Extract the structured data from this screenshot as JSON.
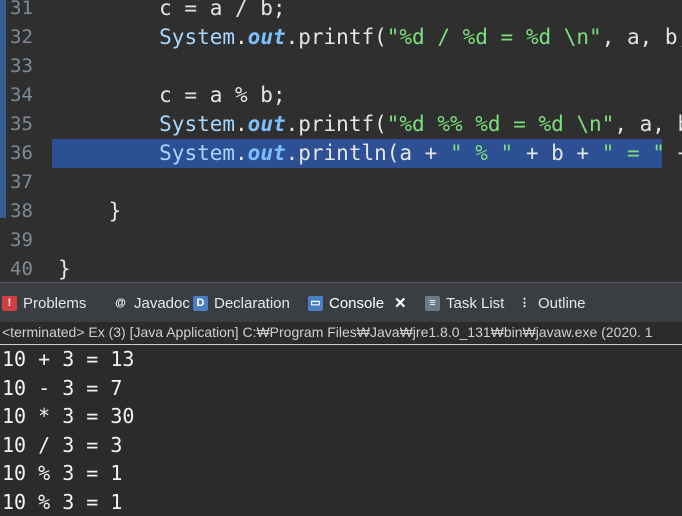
{
  "editor": {
    "lines": [
      {
        "num": "31",
        "tokens": [
          {
            "t": "        c = a / b;",
            "c": "plain"
          }
        ]
      },
      {
        "num": "32",
        "tokens": [
          {
            "t": "        ",
            "c": "plain"
          },
          {
            "t": "System",
            "c": "cls"
          },
          {
            "t": ".",
            "c": "plain"
          },
          {
            "t": "out",
            "c": "fld"
          },
          {
            "t": ".printf(",
            "c": "plain"
          },
          {
            "t": "\"%d / %d = %d \\n\"",
            "c": "str"
          },
          {
            "t": ", a, b, c);",
            "c": "plain"
          }
        ]
      },
      {
        "num": "33",
        "tokens": []
      },
      {
        "num": "34",
        "tokens": [
          {
            "t": "        c = a % b;",
            "c": "plain"
          }
        ]
      },
      {
        "num": "35",
        "tokens": [
          {
            "t": "        ",
            "c": "plain"
          },
          {
            "t": "System",
            "c": "cls"
          },
          {
            "t": ".",
            "c": "plain"
          },
          {
            "t": "out",
            "c": "fld"
          },
          {
            "t": ".printf(",
            "c": "plain"
          },
          {
            "t": "\"%d %% %d = %d \\n\"",
            "c": "str"
          },
          {
            "t": ", a, b, c);",
            "c": "plain"
          }
        ]
      },
      {
        "num": "36",
        "highlight": true,
        "tokens": [
          {
            "t": "        ",
            "c": "plain"
          },
          {
            "t": "System",
            "c": "cls"
          },
          {
            "t": ".",
            "c": "plain"
          },
          {
            "t": "out",
            "c": "fld"
          },
          {
            "t": ".println(a + ",
            "c": "plain"
          },
          {
            "t": "\" % \"",
            "c": "str"
          },
          {
            "t": " + b + ",
            "c": "plain"
          },
          {
            "t": "\" = \"",
            "c": "str"
          },
          {
            "t": " + c);",
            "c": "plain"
          }
        ]
      },
      {
        "num": "37",
        "tokens": []
      },
      {
        "num": "38",
        "tokens": [
          {
            "t": "    }",
            "c": "plain"
          }
        ]
      },
      {
        "num": "39",
        "tokens": []
      },
      {
        "num": "40",
        "tokens": [
          {
            "t": "}",
            "c": "plain"
          }
        ]
      }
    ]
  },
  "tabs": [
    {
      "label": "Problems",
      "icon": "problems-icon",
      "color": "#d04040",
      "glyph": "!"
    },
    {
      "label": "Javadoc",
      "icon": "javadoc-icon",
      "color": "#3a3d41",
      "glyph": "@"
    },
    {
      "label": "Declaration",
      "icon": "declaration-icon",
      "color": "#4b7fc4",
      "glyph": "D"
    },
    {
      "label": "Console",
      "icon": "console-icon",
      "color": "#4b7fc4",
      "glyph": "▭",
      "active": true,
      "close": "✕"
    },
    {
      "label": "Task List",
      "icon": "task-list-icon",
      "color": "#6c7b8a",
      "glyph": "≡"
    },
    {
      "label": "Outline",
      "icon": "outline-icon",
      "color": "#3a3d41",
      "glyph": "⋮"
    }
  ],
  "status": "<terminated> Ex (3) [Java Application] C:₩Program Files₩Java₩jre1.8.0_131₩bin₩javaw.exe (2020. 1",
  "console": {
    "lines": [
      "10 + 3 = 13",
      "10 - 3 = 7",
      "10 * 3 = 30",
      "10 / 3 = 3",
      "10 % 3 = 1",
      "10 % 3 = 1"
    ]
  }
}
